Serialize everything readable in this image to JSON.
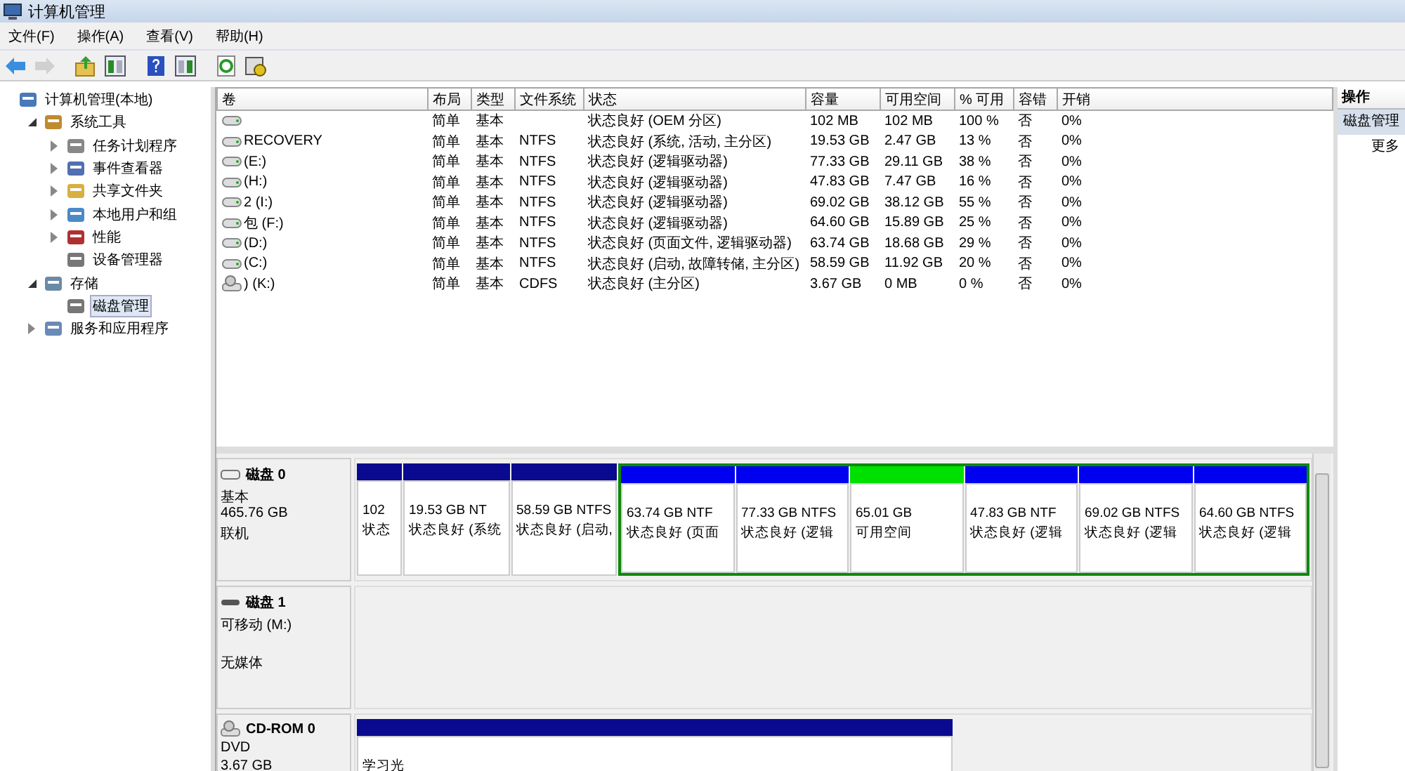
{
  "window": {
    "title": "计算机管理"
  },
  "menu": [
    "文件(F)",
    "操作(A)",
    "查看(V)",
    "帮助(H)"
  ],
  "toolbar": [
    {
      "kind": "back",
      "disabled": false
    },
    {
      "kind": "forward",
      "disabled": true
    },
    {
      "kind": "up",
      "disabled": false
    },
    {
      "kind": "tree",
      "disabled": false
    },
    {
      "kind": "help",
      "disabled": false
    },
    {
      "kind": "pane",
      "disabled": false
    },
    {
      "kind": "refresh",
      "disabled": false
    },
    {
      "kind": "properties",
      "disabled": false
    }
  ],
  "tree": [
    {
      "label": "计算机管理(本地)",
      "kind": "computer",
      "selected": false,
      "children": [
        {
          "label": "系统工具",
          "kind": "tools",
          "expanded": true,
          "selected": false,
          "children": [
            {
              "label": "任务计划程序",
              "kind": "clock",
              "expanded": false,
              "selected": false
            },
            {
              "label": "事件查看器",
              "kind": "book",
              "expanded": false,
              "selected": false
            },
            {
              "label": "共享文件夹",
              "kind": "folder",
              "expanded": false,
              "selected": false
            },
            {
              "label": "本地用户和组",
              "kind": "users",
              "expanded": false,
              "selected": false
            },
            {
              "label": "性能",
              "kind": "gauge",
              "expanded": false,
              "selected": false
            },
            {
              "label": "设备管理器",
              "kind": "device",
              "selected": false
            }
          ]
        },
        {
          "label": "存储",
          "kind": "storage",
          "expanded": true,
          "selected": false,
          "children": [
            {
              "label": "磁盘管理",
              "kind": "disk",
              "selected": true
            }
          ]
        },
        {
          "label": "服务和应用程序",
          "kind": "services",
          "expanded": false,
          "selected": false
        }
      ]
    }
  ],
  "volumes": {
    "columns": [
      "卷",
      "布局",
      "类型",
      "文件系统",
      "状态",
      "容量",
      "可用空间",
      "% 可用",
      "容错",
      "开销"
    ],
    "rows": [
      {
        "kind": "disk",
        "layout": "简单",
        "type": "基本",
        "status": "状态良好 (OEM 分区)",
        "capacity": "102 MB",
        "free": "102 MB",
        "pct": "100 %",
        "fault": "否",
        "overhead": "0%"
      },
      {
        "kind": "disk",
        "name": "RECOVERY",
        "layout": "简单",
        "type": "基本",
        "fs": "NTFS",
        "status": "状态良好 (系统, 活动, 主分区)",
        "capacity": "19.53 GB",
        "free": "2.47 GB",
        "pct": "13 %",
        "fault": "否",
        "overhead": "0%"
      },
      {
        "kind": "disk",
        "name": "(E:)",
        "layout": "简单",
        "type": "基本",
        "fs": "NTFS",
        "status": "状态良好 (逻辑驱动器)",
        "capacity": "77.33 GB",
        "free": "29.11 GB",
        "pct": "38 %",
        "fault": "否",
        "overhead": "0%"
      },
      {
        "kind": "disk",
        "name": "(H:)",
        "layout": "简单",
        "type": "基本",
        "fs": "NTFS",
        "status": "状态良好 (逻辑驱动器)",
        "capacity": "47.83 GB",
        "free": "7.47 GB",
        "pct": "16 %",
        "fault": "否",
        "overhead": "0%"
      },
      {
        "kind": "disk",
        "name": "2 (I:)",
        "layout": "简单",
        "type": "基本",
        "fs": "NTFS",
        "status": "状态良好 (逻辑驱动器)",
        "capacity": "69.02 GB",
        "free": "38.12 GB",
        "pct": "55 %",
        "fault": "否",
        "overhead": "0%"
      },
      {
        "kind": "disk",
        "name": "包 (F:)",
        "layout": "简单",
        "type": "基本",
        "fs": "NTFS",
        "status": "状态良好 (逻辑驱动器)",
        "capacity": "64.60 GB",
        "free": "15.89 GB",
        "pct": "25 %",
        "fault": "否",
        "overhead": "0%"
      },
      {
        "kind": "disk",
        "name": "(D:)",
        "layout": "简单",
        "type": "基本",
        "fs": "NTFS",
        "status": "状态良好 (页面文件, 逻辑驱动器)",
        "capacity": "63.74 GB",
        "free": "18.68 GB",
        "pct": "29 %",
        "fault": "否",
        "overhead": "0%"
      },
      {
        "kind": "disk",
        "name": "(C:)",
        "layout": "简单",
        "type": "基本",
        "fs": "NTFS",
        "status": "状态良好 (启动, 故障转储, 主分区)",
        "capacity": "58.59 GB",
        "free": "11.92 GB",
        "pct": "20 %",
        "fault": "否",
        "overhead": "0%"
      },
      {
        "kind": "cdrom",
        "name": ") (K:)",
        "layout": "简单",
        "type": "基本",
        "fs": "CDFS",
        "status": "状态良好 (主分区)",
        "capacity": "3.67 GB",
        "free": "0 MB",
        "pct": "0 %",
        "fault": "否",
        "overhead": "0%"
      }
    ]
  },
  "disks": [
    {
      "kind": "disk",
      "name": "磁盘 0",
      "lines": [
        "基本",
        "465.76 GB",
        "联机"
      ],
      "partitions": [
        {
          "kind": "primary",
          "size": "102",
          "status": "状态"
        },
        {
          "kind": "primary",
          "size": "19.53 GB NT",
          "status": "状态良好 (系统"
        },
        {
          "kind": "primary",
          "size": "58.59 GB NTFS",
          "status": "状态良好 (启动,"
        }
      ],
      "extended": [
        {
          "kind": "logical",
          "size": "63.74 GB NTF",
          "status": "状态良好 (页面"
        },
        {
          "kind": "logical",
          "size": "77.33 GB NTFS",
          "status": "状态良好 (逻辑"
        },
        {
          "kind": "free",
          "size": "65.01 GB",
          "status": "可用空间"
        },
        {
          "kind": "logical",
          "size": "47.83 GB NTF",
          "status": "状态良好 (逻辑"
        },
        {
          "kind": "logical",
          "size": "69.02 GB NTFS",
          "status": "状态良好 (逻辑"
        },
        {
          "kind": "logical",
          "size": "64.60 GB NTFS",
          "status": "状态良好 (逻辑"
        }
      ]
    },
    {
      "kind": "removable",
      "name": "磁盘 1",
      "lines": [
        "可移动 (M:)",
        "无媒体"
      ]
    },
    {
      "kind": "cdrom",
      "name": "CD-ROM 0",
      "lines": [
        "DVD",
        "3.67 GB"
      ],
      "partitions": [
        {
          "kind": "primary",
          "size": "学习光"
        }
      ]
    }
  ],
  "actions": {
    "title": "操作",
    "items": [
      {
        "label": "磁盘管理",
        "selected": true
      },
      {
        "label": "更多",
        "selected": false
      }
    ]
  }
}
